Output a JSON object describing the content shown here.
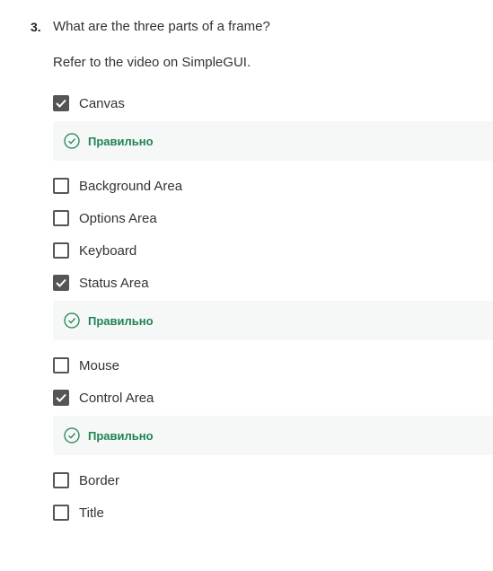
{
  "question": {
    "number": "3.",
    "text": "What are the three parts of a frame?",
    "hint": "Refer to the video on SimpleGUI."
  },
  "options": [
    {
      "label": "Canvas",
      "checked": true,
      "feedback": "Правильно"
    },
    {
      "label": "Background Area",
      "checked": false
    },
    {
      "label": "Options Area",
      "checked": false
    },
    {
      "label": "Keyboard",
      "checked": false
    },
    {
      "label": "Status Area",
      "checked": true,
      "feedback": "Правильно"
    },
    {
      "label": "Mouse",
      "checked": false
    },
    {
      "label": "Control Area",
      "checked": true,
      "feedback": "Правильно"
    },
    {
      "label": "Border",
      "checked": false
    },
    {
      "label": "Title",
      "checked": false
    }
  ],
  "colors": {
    "checkbox": "#555555",
    "correct": "#1f8354",
    "feedback_bg": "#f5f8f6"
  },
  "icons": {
    "checked": "checkmark-icon",
    "correct": "check-circle-icon"
  }
}
